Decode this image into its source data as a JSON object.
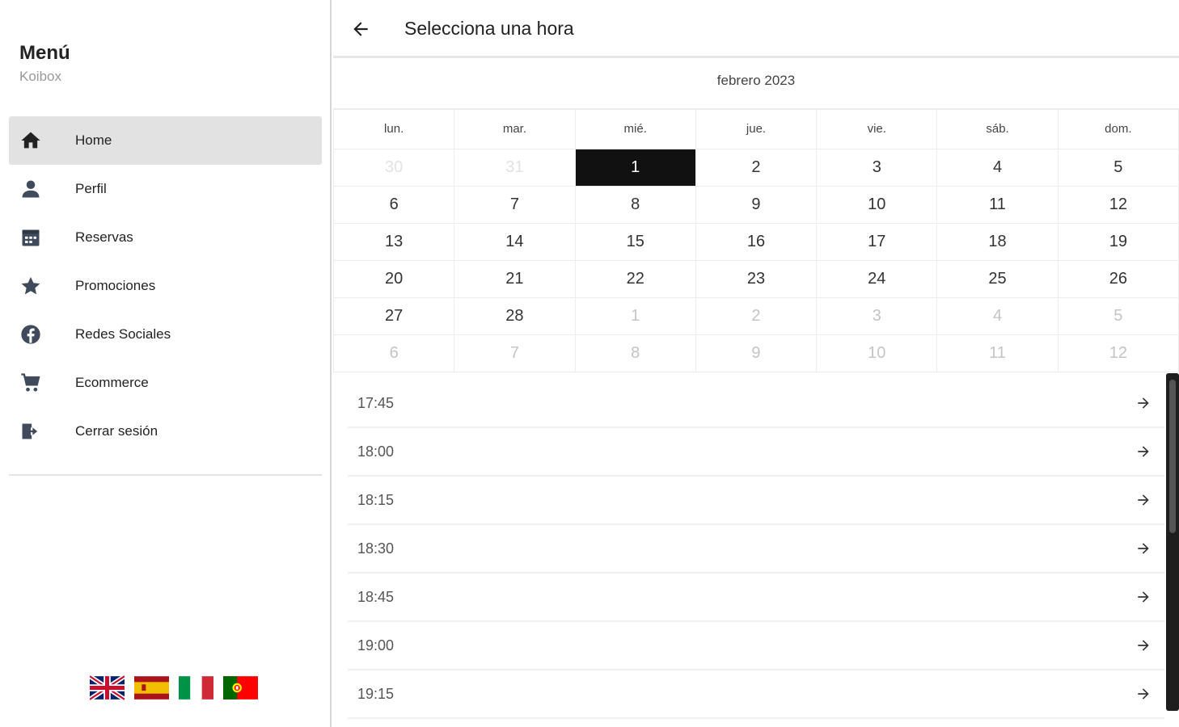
{
  "sidebar": {
    "title": "Menú",
    "subtitle": "Koibox",
    "items": [
      {
        "label": "Home",
        "icon": "home-icon"
      },
      {
        "label": "Perfil",
        "icon": "person-icon"
      },
      {
        "label": "Reservas",
        "icon": "calendar-icon"
      },
      {
        "label": "Promociones",
        "icon": "star-icon"
      },
      {
        "label": "Redes Sociales",
        "icon": "facebook-icon"
      },
      {
        "label": "Ecommerce",
        "icon": "cart-icon"
      },
      {
        "label": "Cerrar sesión",
        "icon": "logout-icon"
      }
    ],
    "active_item": "Home",
    "languages": [
      "uk-flag",
      "spain-flag",
      "italy-flag",
      "portugal-flag"
    ]
  },
  "header": {
    "title": "Selecciona una hora",
    "back_icon": "arrow-left-icon"
  },
  "calendar": {
    "month": "febrero 2023",
    "weekdays": [
      "lun.",
      "mar.",
      "mié.",
      "jue.",
      "vie.",
      "sáb.",
      "dom."
    ],
    "selected_day": "1",
    "weeks": [
      [
        "30",
        "31",
        "1",
        "2",
        "3",
        "4",
        "5"
      ],
      [
        "6",
        "7",
        "8",
        "9",
        "10",
        "11",
        "12"
      ],
      [
        "13",
        "14",
        "15",
        "16",
        "17",
        "18",
        "19"
      ],
      [
        "20",
        "21",
        "22",
        "23",
        "24",
        "25",
        "26"
      ],
      [
        "27",
        "28",
        "1",
        "2",
        "3",
        "4",
        "5"
      ],
      [
        "6",
        "7",
        "8",
        "9",
        "10",
        "11",
        "12"
      ]
    ]
  },
  "times": {
    "slots": [
      "17:45",
      "18:00",
      "18:15",
      "18:30",
      "18:45",
      "19:00",
      "19:15"
    ],
    "arrow_icon": "arrow-right-icon"
  },
  "colors": {
    "selected_bg": "#111111",
    "active_nav_bg": "#e2e2e2",
    "icon_color": "#3f4a5c"
  }
}
